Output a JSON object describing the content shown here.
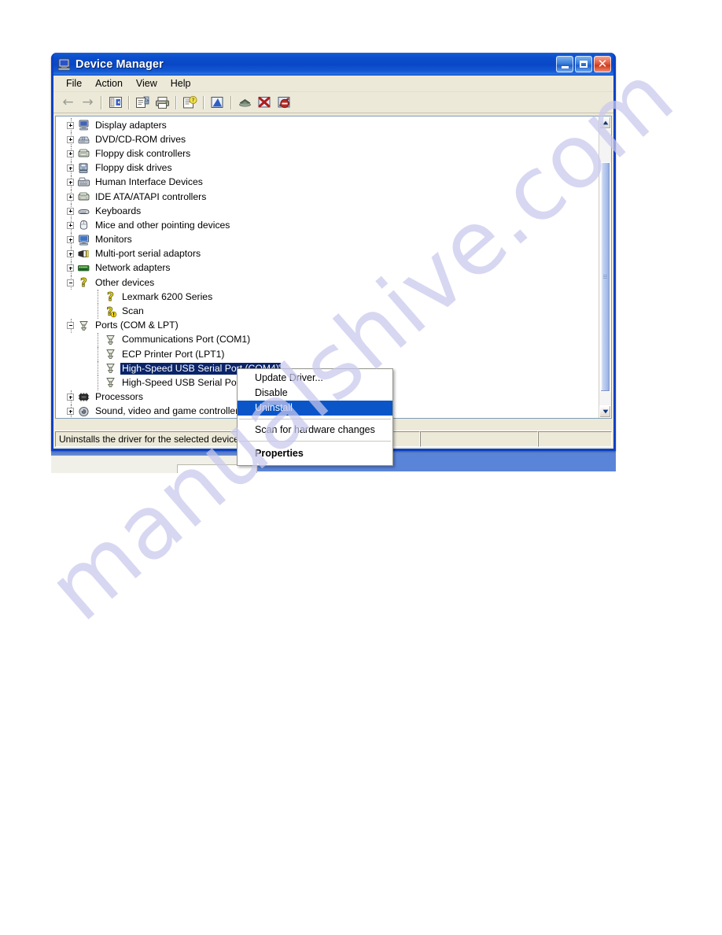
{
  "window": {
    "title": "Device Manager",
    "title_icon": "computer-icon",
    "buttons": {
      "minimize": "Minimize",
      "maximize": "Maximize",
      "close": "Close"
    }
  },
  "menu_bar": {
    "items": [
      {
        "label": "File"
      },
      {
        "label": "Action"
      },
      {
        "label": "View"
      },
      {
        "label": "Help"
      }
    ]
  },
  "toolbar": {
    "buttons": [
      {
        "icon": "back-arrow-icon",
        "label": "Back"
      },
      {
        "icon": "forward-arrow-icon",
        "label": "Forward"
      },
      {
        "icon": "show-hide-console-tree-icon",
        "label": "Show/Hide Console Tree"
      },
      {
        "icon": "properties-icon",
        "label": "Properties"
      },
      {
        "icon": "print-icon",
        "label": "Print"
      },
      {
        "icon": "help-properties-icon",
        "label": "Help"
      },
      {
        "icon": "update-driver-icon",
        "label": "Update Driver"
      },
      {
        "icon": "scan-hardware-changes-icon",
        "label": "Scan for hardware changes"
      },
      {
        "icon": "disable-device-icon",
        "label": "Disable"
      },
      {
        "icon": "uninstall-device-icon",
        "label": "Uninstall"
      }
    ]
  },
  "tree": {
    "rows": [
      {
        "label": "Display adapters",
        "depth": 1,
        "expander": "plus",
        "icon": "display-adapter-icon",
        "selected": false
      },
      {
        "label": "DVD/CD-ROM drives",
        "depth": 1,
        "expander": "plus",
        "icon": "dvd-drive-icon",
        "selected": false
      },
      {
        "label": "Floppy disk controllers",
        "depth": 1,
        "expander": "plus",
        "icon": "floppy-controller-icon",
        "selected": false
      },
      {
        "label": "Floppy disk drives",
        "depth": 1,
        "expander": "plus",
        "icon": "floppy-drive-icon",
        "selected": false
      },
      {
        "label": "Human Interface Devices",
        "depth": 1,
        "expander": "plus",
        "icon": "hid-icon",
        "selected": false
      },
      {
        "label": "IDE ATA/ATAPI controllers",
        "depth": 1,
        "expander": "plus",
        "icon": "ide-controller-icon",
        "selected": false
      },
      {
        "label": "Keyboards",
        "depth": 1,
        "expander": "plus",
        "icon": "keyboard-icon",
        "selected": false
      },
      {
        "label": "Mice and other pointing devices",
        "depth": 1,
        "expander": "plus",
        "icon": "mouse-icon",
        "selected": false
      },
      {
        "label": "Monitors",
        "depth": 1,
        "expander": "plus",
        "icon": "monitor-icon",
        "selected": false
      },
      {
        "label": "Multi-port serial adaptors",
        "depth": 1,
        "expander": "plus",
        "icon": "multiport-serial-icon",
        "selected": false
      },
      {
        "label": "Network adapters",
        "depth": 1,
        "expander": "plus",
        "icon": "network-adapter-icon",
        "selected": false
      },
      {
        "label": "Other devices",
        "depth": 1,
        "expander": "minus",
        "icon": "unknown-device-icon",
        "selected": false
      },
      {
        "label": "Lexmark 6200 Series",
        "depth": 2,
        "expander": "none",
        "icon": "unknown-device-icon",
        "selected": false
      },
      {
        "label": "Scan",
        "depth": 2,
        "expander": "none",
        "icon": "unknown-device-warning-icon",
        "selected": false
      },
      {
        "label": "Ports (COM & LPT)",
        "depth": 1,
        "expander": "minus",
        "icon": "port-icon",
        "selected": false
      },
      {
        "label": "Communications Port (COM1)",
        "depth": 2,
        "expander": "none",
        "icon": "port-icon",
        "selected": false
      },
      {
        "label": "ECP Printer Port (LPT1)",
        "depth": 2,
        "expander": "none",
        "icon": "port-icon",
        "selected": false
      },
      {
        "label": "High-Speed USB Serial Port (COM4)",
        "depth": 2,
        "expander": "none",
        "icon": "port-icon",
        "selected": true
      },
      {
        "label": "High-Speed USB Serial Port (COM5)",
        "depth": 2,
        "expander": "none",
        "icon": "port-icon",
        "selected": false
      },
      {
        "label": "Processors",
        "depth": 1,
        "expander": "plus",
        "icon": "processor-icon",
        "selected": false
      },
      {
        "label": "Sound, video and game controllers",
        "depth": 1,
        "expander": "plus",
        "icon": "sound-device-icon",
        "selected": false
      }
    ]
  },
  "scrollbar": {
    "up_arrow": "▲",
    "down_arrow": "▼"
  },
  "status_bar": {
    "message": "Uninstalls the driver for the selected device",
    "pane2": "",
    "pane3": ""
  },
  "context_menu": {
    "items": [
      {
        "label": "Update Driver...",
        "type": "item",
        "highlighted": false,
        "bold": false
      },
      {
        "label": "Disable",
        "type": "item",
        "highlighted": false,
        "bold": false
      },
      {
        "label": "Uninstall",
        "type": "item",
        "highlighted": true,
        "bold": false
      },
      {
        "label": "",
        "type": "separator",
        "highlighted": false,
        "bold": false
      },
      {
        "label": "Scan for hardware changes",
        "type": "item",
        "highlighted": false,
        "bold": false
      },
      {
        "label": "",
        "type": "separator",
        "highlighted": false,
        "bold": false
      },
      {
        "label": "Properties",
        "type": "item",
        "highlighted": false,
        "bold": true
      }
    ]
  },
  "watermark": {
    "text": "manualshive.com",
    "color": "#c9c9ee"
  },
  "colors": {
    "title_bar_blue": "#0a47c6",
    "window_border_blue": "#0a41c4",
    "client_beige": "#ece9d8",
    "selection_blue": "#0a246a",
    "menu_highlight_blue": "#0a56c8"
  }
}
